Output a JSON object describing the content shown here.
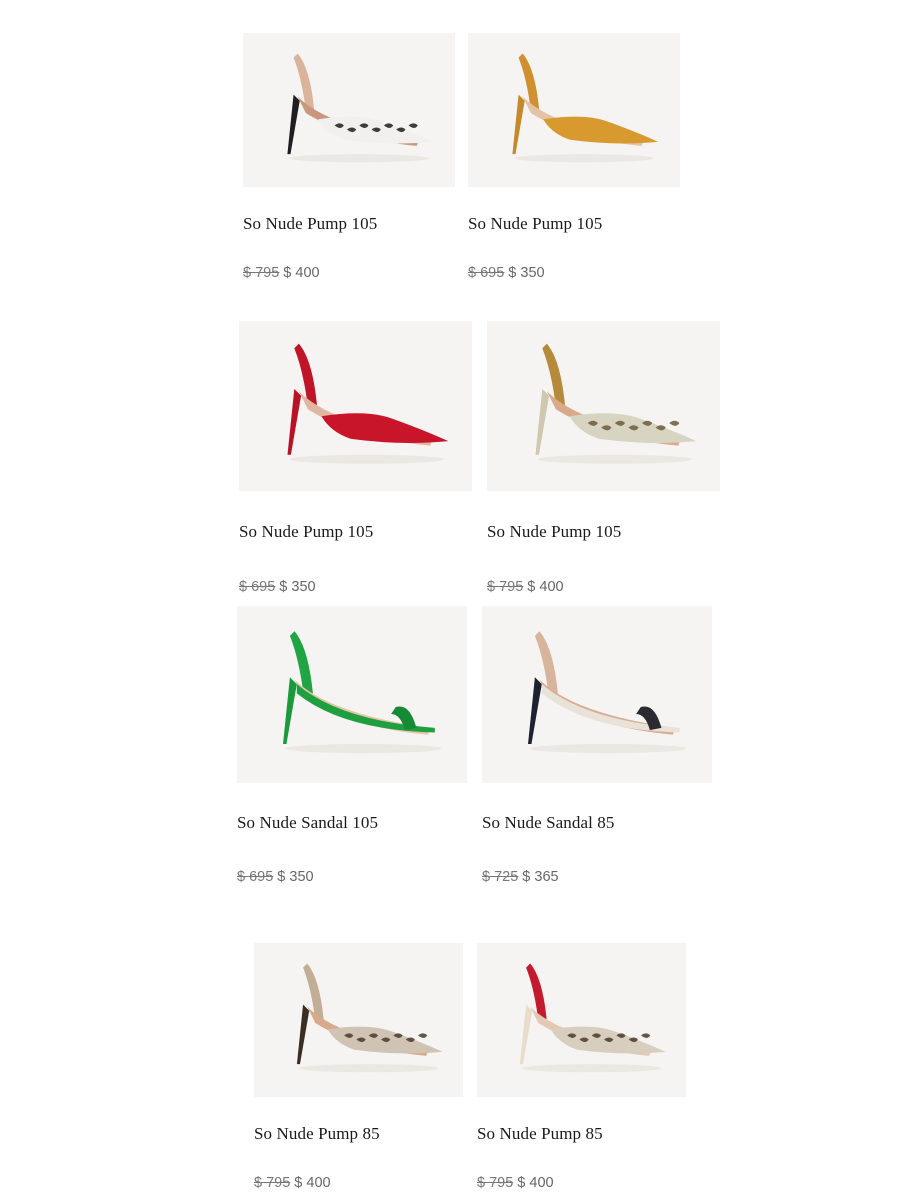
{
  "products": [
    {
      "name": "So Nude Pump 105",
      "price_original": "$ 795",
      "price_sale": "$ 400",
      "style": "slingback pump",
      "colors": {
        "upper": "#f2f0ee",
        "pattern": "#1c1c1c",
        "heel": "#1f1f22",
        "strap": "#d9b49a",
        "lining": "#c9987c"
      }
    },
    {
      "name": "So Nude Pump 105",
      "price_original": "$ 695",
      "price_sale": "$ 350",
      "style": "suede pump",
      "colors": {
        "upper": "#d89a2e",
        "pattern": "#c98a22",
        "heel": "#c48a2a",
        "strap": "#d09030",
        "lining": "#e4c2a6"
      }
    },
    {
      "name": "So Nude Pump 105",
      "price_original": "$ 695",
      "price_sale": "$ 350",
      "style": "slingback pump",
      "colors": {
        "upper": "#c8152a",
        "pattern": "#b0101f",
        "heel": "#b91226",
        "strap": "#c01428",
        "lining": "#e0b7a0"
      }
    },
    {
      "name": "So Nude Pump 105",
      "price_original": "$ 795",
      "price_sale": "$ 400",
      "style": "snakeskin slingback",
      "colors": {
        "upper": "#d8d4c2",
        "pattern": "#6b5a3a",
        "heel": "#cfc7b0",
        "strap": "#b58a3a",
        "lining": "#d8a98a"
      }
    },
    {
      "name": "So Nude Sandal 105",
      "price_original": "$ 695",
      "price_sale": "$ 350",
      "style": "sandal",
      "colors": {
        "upper": "#1fa040",
        "pattern": "#168a35",
        "heel": "#1b9a3c",
        "strap": "#20a444",
        "lining": "#e7c3a8"
      }
    },
    {
      "name": "So Nude Sandal 85",
      "price_original": "$ 725",
      "price_sale": "$ 365",
      "style": "sandal",
      "colors": {
        "upper": "#e8e2d8",
        "pattern": "#2a2a30",
        "heel": "#1e2230",
        "strap": "#d8b49c",
        "lining": "#d9ae92"
      }
    },
    {
      "name": "So Nude Pump 85",
      "price_original": "$ 795",
      "price_sale": "$ 400",
      "style": "snakeskin slingback",
      "colors": {
        "upper": "#cfc4b4",
        "pattern": "#4a3a2c",
        "heel": "#3a2e24",
        "strap": "#c2ad97",
        "lining": "#d9a98c"
      }
    },
    {
      "name": "So Nude Pump 85",
      "price_original": "$ 795",
      "price_sale": "$ 400",
      "style": "snakeskin slingback",
      "colors": {
        "upper": "#d8cebd",
        "pattern": "#4a3a2c",
        "heel": "#e8dccb",
        "strap": "#c41a2e",
        "lining": "#e3c9b4"
      }
    }
  ]
}
